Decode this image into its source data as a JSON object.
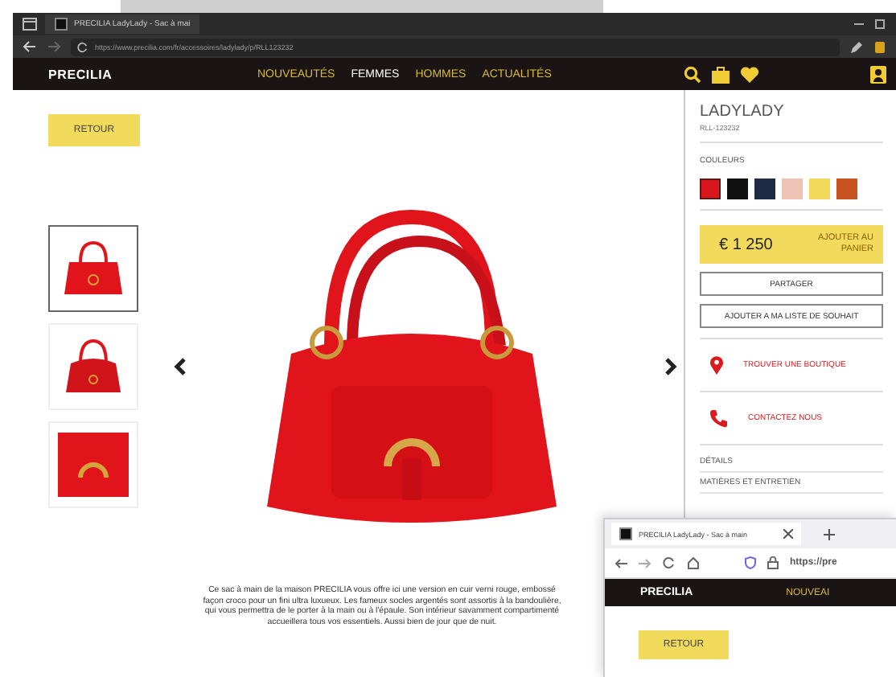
{
  "browser": {
    "tab_title": "PRECILIA LadyLady - Sac à mai",
    "url": "https://www.precilia.com/fr/accessoires/ladylady/p/RLL123232"
  },
  "site_nav": {
    "logo": "PRECILIA",
    "links": [
      {
        "label": "NOUVEAUTÉS",
        "selected": false
      },
      {
        "label": "FEMMES",
        "selected": true
      },
      {
        "label": "HOMMES",
        "selected": false
      },
      {
        "label": "ACTUALITÉS",
        "selected": false
      }
    ]
  },
  "back_button": "RETOUR",
  "gallery": {
    "thumbnails": [
      {
        "kind": "front",
        "selected": true
      },
      {
        "kind": "back",
        "selected": false
      },
      {
        "kind": "detail",
        "selected": false
      }
    ]
  },
  "description": "Ce sac à main de la maison PRECILIA vous offre ici une version en cuir verni rouge, embossé façon croco pour un fini ultra luxueux. Les fameux socles argentés sont assortis à la bandoulière, qui vous permettra de le porter à la main ou à l'épaule. Son intérieur savamment compartimenté accueillera tous vos essentiels. Aussi bien de jour que de nuit.",
  "product": {
    "name": "LADYLADY",
    "ref": "RLL-123232",
    "colors_label": "COULEURS",
    "swatches": [
      {
        "color": "#d8161b",
        "selected": true
      },
      {
        "color": "#111111",
        "selected": false
      },
      {
        "color": "#1e2b45",
        "selected": false
      },
      {
        "color": "#efc2b6",
        "selected": false
      },
      {
        "color": "#f3d95a",
        "selected": false
      },
      {
        "color": "#c8531e",
        "selected": false
      }
    ],
    "price": "€ 1 250",
    "add_to_cart": "AJOUTER AU PANIER",
    "actions": [
      "PARTAGER",
      "AJOUTER A MA LISTE DE SOUHAIT"
    ],
    "links": [
      {
        "kind": "store",
        "label": "TROUVER UNE BOUTIQUE"
      },
      {
        "kind": "phone",
        "label": "CONTACTEZ NOUS"
      }
    ],
    "sections": [
      "DÉTAILS",
      "MATIÈRES ET ENTRETIEN"
    ]
  },
  "second_window": {
    "tab_title": "PRECILIA LadyLady - Sac à main",
    "url": "https://pre",
    "logo": "PRECILIA",
    "nav_link": "NOUVEAI",
    "back_button": "RETOUR"
  }
}
